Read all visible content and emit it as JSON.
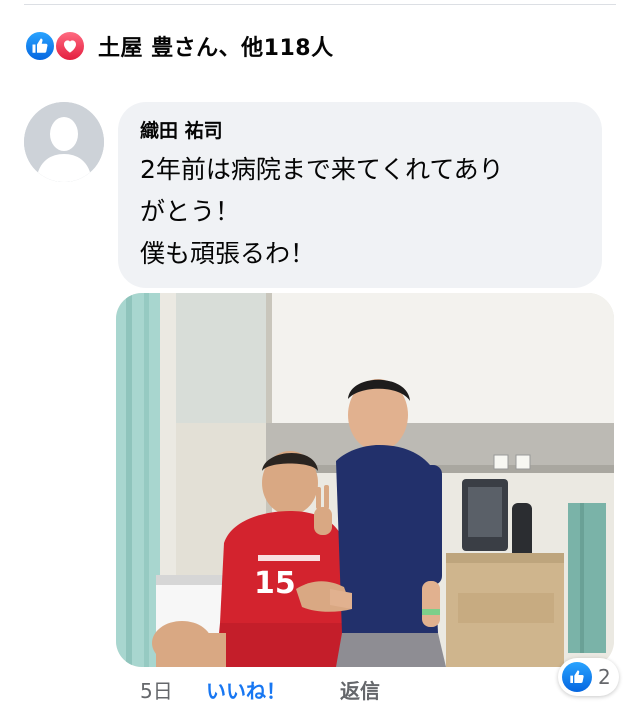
{
  "reactions": {
    "summary": "土屋 豊さん、他118人",
    "icons": [
      "like-icon",
      "love-icon"
    ]
  },
  "comment": {
    "author": "織田 祐司",
    "lines": [
      "2年前は病院まで来てくれてあり",
      "がとう！",
      "僕も頑張るわ！"
    ],
    "time": "5日",
    "like_label": "いいね！",
    "reply_label": "返信",
    "reaction_count": "2"
  },
  "colors": {
    "accent": "#1877f2",
    "bubble": "#f0f2f5",
    "secondary_text": "#65676b",
    "love": "#e41e3f"
  },
  "photo": {
    "jersey_number": "15"
  }
}
